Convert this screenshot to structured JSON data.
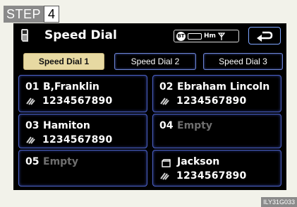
{
  "step": {
    "label": "STEP",
    "number": "4"
  },
  "header": {
    "title": "Speed Dial",
    "status": {
      "bt_label": "BT",
      "hm_label": "Hm"
    },
    "back_icon": "return-arrow-icon"
  },
  "tabs": [
    {
      "label": "Speed Dial 1",
      "active": true
    },
    {
      "label": "Speed Dial 2",
      "active": false
    },
    {
      "label": "Speed Dial 3",
      "active": false
    }
  ],
  "entries": [
    {
      "slot": "01",
      "name": "B,Franklin",
      "number": "1234567890",
      "icon": "mobile-phone-icon"
    },
    {
      "slot": "02",
      "name": "Ebraham Lincoln",
      "number": "1234567890",
      "icon": "mobile-phone-icon"
    },
    {
      "slot": "03",
      "name": "Hamiton",
      "number": "1234567890",
      "icon": "mobile-phone-icon"
    },
    {
      "slot": "04",
      "name": "Empty",
      "number": ""
    },
    {
      "slot": "05",
      "name": "Empty",
      "number": ""
    },
    {
      "slot": "",
      "name": "Jackson",
      "number": "1234567890",
      "icon": "mobile-phone-icon",
      "name_icon": "home-phone-icon"
    }
  ],
  "image_code": "ILY31G033",
  "colors": {
    "accent_border": "#4e63c9",
    "active_tab": "#e7d9a2",
    "empty_text": "#6f6f6f"
  }
}
